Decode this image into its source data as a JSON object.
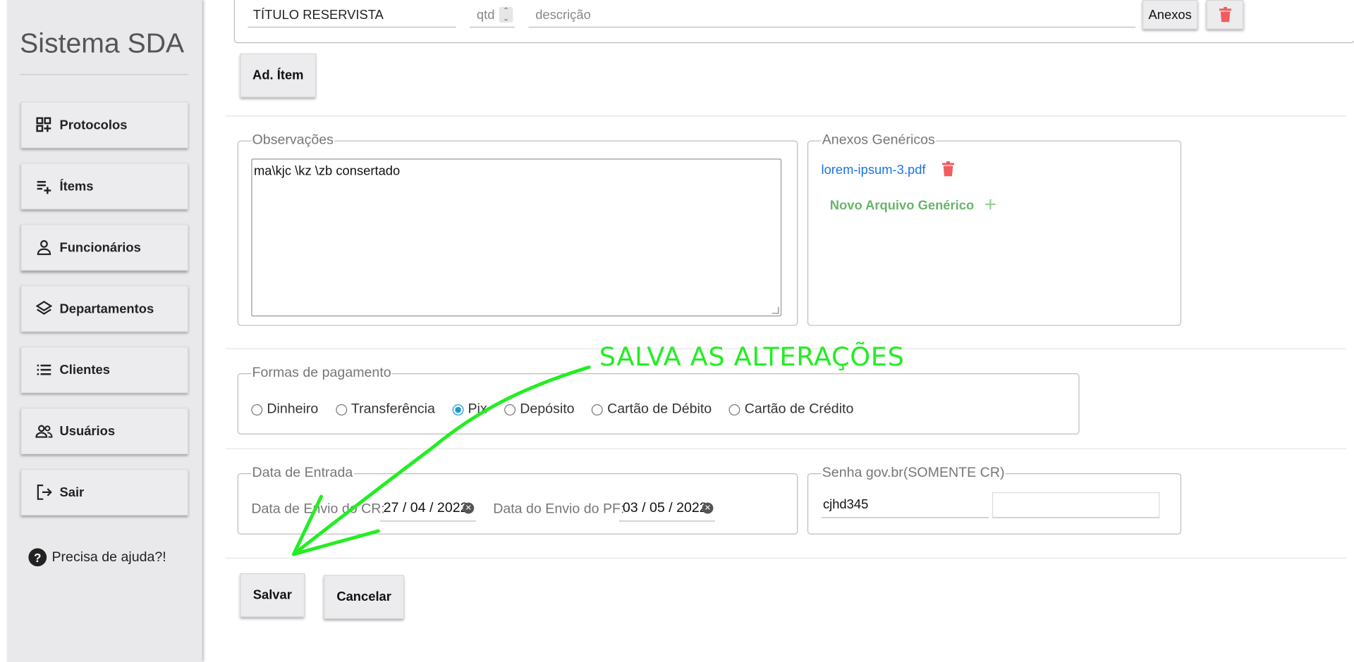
{
  "sidebar": {
    "brand": "Sistema SDA",
    "items": [
      {
        "label": "Protocolos",
        "icon": "protocols-icon"
      },
      {
        "label": "Ítems",
        "icon": "playlist-add-icon"
      },
      {
        "label": "Funcionários",
        "icon": "person-icon"
      },
      {
        "label": "Departamentos",
        "icon": "layers-icon"
      },
      {
        "label": "Clientes",
        "icon": "list-icon"
      },
      {
        "label": "Usuários",
        "icon": "group-icon"
      },
      {
        "label": "Sair",
        "icon": "logout-icon"
      }
    ],
    "help": "Precisa de ajuda?!"
  },
  "item_row": {
    "title_value": "TÍTULO RESERVISTA",
    "qty_placeholder": "qtd",
    "desc_placeholder": "descrição",
    "attachments_label": "Anexos"
  },
  "add_item_label": "Ad. Ítem",
  "observacoes": {
    "legend": "Observações",
    "value": "ma\\kjc \\kz \\zb  consertado"
  },
  "anexos_genericos": {
    "legend": "Anexos Genéricos",
    "file": "lorem-ipsum-3.pdf",
    "new_file_label": "Novo Arquivo Genérico"
  },
  "annotation": "SALVA AS ALTERAÇÕES",
  "pagamento": {
    "legend": "Formas de pagamento",
    "options": [
      "Dinheiro",
      "Transferência",
      "Pix",
      "Depósito",
      "Cartão de Débito",
      "Cartão de Crédito"
    ],
    "selected": "Pix"
  },
  "data_entrada": {
    "legend": "Data de Entrada",
    "cr_label": "Data de Envio do CR:",
    "cr_value": "27 / 04 / 2022",
    "pf_label": "Data do Envio do PF:",
    "pf_value": "03 / 05 / 2022"
  },
  "senha": {
    "legend": "Senha gov.br(SOMENTE CR)",
    "value": "cjhd345",
    "second_value": ""
  },
  "actions": {
    "save": "Salvar",
    "cancel": "Cancelar"
  },
  "colors": {
    "annotation": "#22ee22",
    "danger": "#f25c5c",
    "link": "#1a73e8",
    "new_file": "#6ab46a",
    "radio_selected": "#1a9bd7"
  }
}
